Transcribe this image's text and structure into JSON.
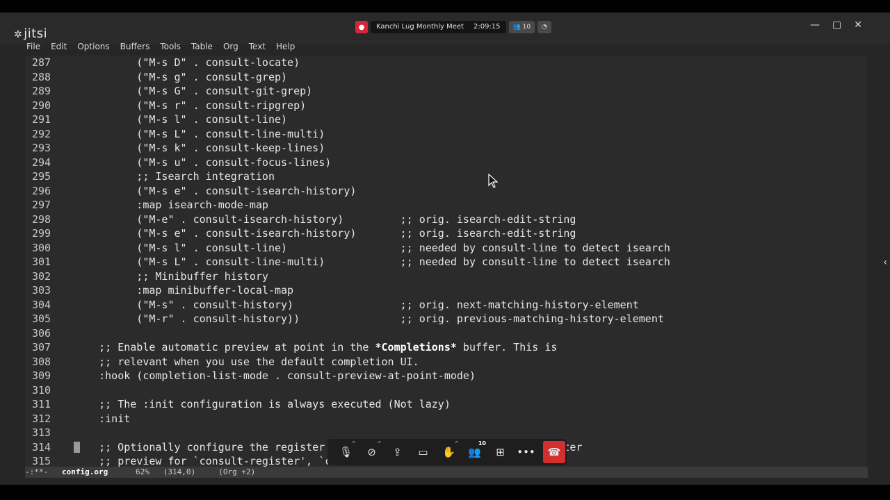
{
  "app": {
    "logo_text": "jitsi"
  },
  "menu": [
    "File",
    "Edit",
    "Options",
    "Buffers",
    "Tools",
    "Table",
    "Org",
    "Text",
    "Help"
  ],
  "meeting": {
    "title": "Kanchi Lug Monthly Meet",
    "timer": "2:09:15",
    "participants": "10"
  },
  "code_lines": [
    {
      "n": "287",
      "t": "          (\"M-s D\" . consult-locate)"
    },
    {
      "n": "288",
      "t": "          (\"M-s g\" . consult-grep)"
    },
    {
      "n": "289",
      "t": "          (\"M-s G\" . consult-git-grep)"
    },
    {
      "n": "290",
      "t": "          (\"M-s r\" . consult-ripgrep)"
    },
    {
      "n": "291",
      "t": "          (\"M-s l\" . consult-line)"
    },
    {
      "n": "292",
      "t": "          (\"M-s L\" . consult-line-multi)"
    },
    {
      "n": "293",
      "t": "          (\"M-s k\" . consult-keep-lines)"
    },
    {
      "n": "294",
      "t": "          (\"M-s u\" . consult-focus-lines)"
    },
    {
      "n": "295",
      "t": "          ;; Isearch integration"
    },
    {
      "n": "296",
      "t": "          (\"M-s e\" . consult-isearch-history)"
    },
    {
      "n": "297",
      "t": "          :map isearch-mode-map"
    },
    {
      "n": "298",
      "t": "          (\"M-e\" . consult-isearch-history)         ;; orig. isearch-edit-string"
    },
    {
      "n": "299",
      "t": "          (\"M-s e\" . consult-isearch-history)       ;; orig. isearch-edit-string"
    },
    {
      "n": "300",
      "t": "          (\"M-s l\" . consult-line)                  ;; needed by consult-line to detect isearch"
    },
    {
      "n": "301",
      "t": "          (\"M-s L\" . consult-line-multi)            ;; needed by consult-line to detect isearch"
    },
    {
      "n": "302",
      "t": "          ;; Minibuffer history"
    },
    {
      "n": "303",
      "t": "          :map minibuffer-local-map"
    },
    {
      "n": "304",
      "t": "          (\"M-s\" . consult-history)                 ;; orig. next-matching-history-element"
    },
    {
      "n": "305",
      "t": "          (\"M-r\" . consult-history))                ;; orig. previous-matching-history-element"
    },
    {
      "n": "306",
      "t": ""
    },
    {
      "n": "307",
      "t": "    ;; Enable automatic preview at point in the ",
      "bold": "*Completions*",
      "tail": " buffer. This is"
    },
    {
      "n": "308",
      "t": "    ;; relevant when you use the default completion UI."
    },
    {
      "n": "309",
      "t": "    :hook (completion-list-mode . consult-preview-at-point-mode)"
    },
    {
      "n": "310",
      "t": ""
    },
    {
      "n": "311",
      "t": "    ;; The :init configuration is always executed (Not lazy)"
    },
    {
      "n": "312",
      "t": "    :init"
    },
    {
      "n": "313",
      "t": ""
    },
    {
      "n": "314",
      "t": "    ;; Optionally configure the register                                     ster",
      "cursor": true
    },
    {
      "n": "315",
      "t": "    ;; preview for `consult-register', `c"
    }
  ],
  "modeline": {
    "state": "-:**-",
    "file": "config.org",
    "percent": "62%",
    "pos": "(314,0)",
    "mode": "(Org +2)"
  },
  "toolbar": {
    "participants_count": "10"
  },
  "icons": [
    "mic-icon",
    "camera-off-icon",
    "screen-share-icon",
    "chat-icon",
    "raise-hand-icon",
    "participants-icon",
    "tile-view-icon",
    "more-icon",
    "hangup-icon"
  ]
}
